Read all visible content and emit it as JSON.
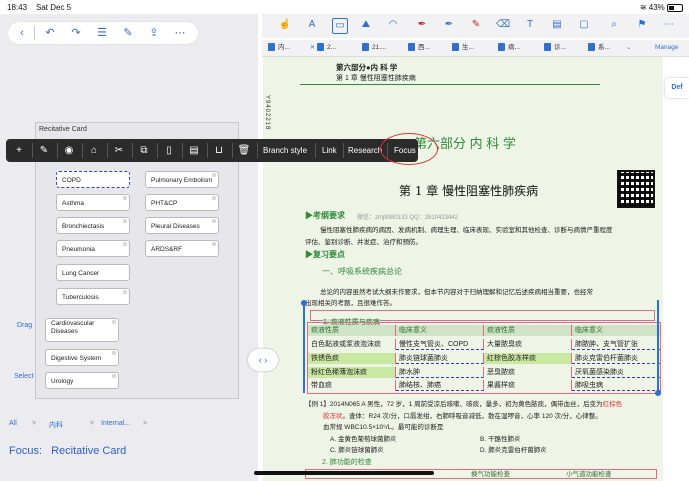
{
  "status": {
    "time": "18:43",
    "date": "Sat Dec 5",
    "battery": "43%"
  },
  "left": {
    "toolbar_icons": [
      "chevron-left-icon",
      "undo-icon",
      "redo-icon",
      "list-icon",
      "edit-icon",
      "share-icon",
      "more-icon"
    ],
    "panel_title": "Recitative Card",
    "cards_left": [
      "COPD",
      "Asthma",
      "Bronchiectasis",
      "Pneumonia",
      "Lung Cancer",
      "Tuberculosis"
    ],
    "cards_right": [
      "Pulmonary Embolism",
      "PHT&CP",
      "Pleural Diseases",
      "ARDS&RF"
    ],
    "cards_bottom": [
      "Cardiovascular Diseases",
      "Digestive System",
      "Urology"
    ],
    "drag_label": "Drag",
    "select_label": "Select",
    "breadcrumb": [
      "All",
      ">",
      "内科",
      ">",
      "Internal...",
      ">"
    ],
    "focus_prefix": "Focus:",
    "focus_value": "Recitative Card"
  },
  "context_menu": {
    "icons": [
      "plus-icon",
      "edit-icon",
      "palette-icon",
      "tag-icon",
      "scissors-icon",
      "copy-icon",
      "document-icon",
      "clipboard-icon",
      "tray-icon",
      "trash-icon"
    ],
    "items": [
      "Branch style",
      "Link",
      "Research",
      "Focus"
    ]
  },
  "right": {
    "tabs": [
      "内...",
      "2...",
      "21....",
      "西...",
      "生...",
      "病...",
      "诊...",
      "系..."
    ],
    "manage": "Manage",
    "def": "Def",
    "page_header_1": "第六部分●内 科 学",
    "page_header_2": "第 1 章  慢性阻塞性肺疾病",
    "side_code": "Y9402218",
    "part_title": "第六部分   内 科 学",
    "chapter_title": "第 1 章   慢性阻塞性肺疾病",
    "exam_req": "▶考纲要求",
    "contact": "微信：zmj8980133   QQ：2610423442",
    "req_text_1": "慢性阻塞性肺疾病的病因、发病机制、病理生理、临床表现、实验室和其他检查、诊断与病情严重程度",
    "req_text_2": "评估、鉴别诊断、并发症、治疗和预防。",
    "review": "▶复习要点",
    "section_1": "一、呼吸系统疾病总论",
    "para_1": "总论的内容虽然考试大纲未作要求，但本节内容对于归纳理解和记忆后述疾病相当重要，也经常",
    "para_2": "出现相关的考题，且很难作答。",
    "table_title": "1. 痰液性质与疾病",
    "table_headers": [
      "痰液性质",
      "临床意义",
      "痰液性质",
      "临床意义"
    ],
    "table_rows": [
      [
        "白色黏液或浆液泡沫痰",
        "慢性支气管炎、COPD",
        "大量脓臭痰",
        "肺脓肿、支气管扩张"
      ],
      [
        "铁锈色痰",
        "肺炎链球菌肺炎",
        "红棕色胶冻样痰",
        "肺炎克雷伯杆菌肺炎"
      ],
      [
        "粉红色稀薄泡沫痰",
        "肺水肿",
        "恶臭脓痰",
        "厌氧菌感染肺炎"
      ],
      [
        "带血痰",
        "肺结核、肺癌",
        "果酱样痰",
        "肺吸虫病"
      ]
    ],
    "example_1": "【例 1】2014N065  A 男性，72 岁，1 周前受凉后咳嗽、咳痰，量多，初为黄色脓痰，偶带血丝，后变为",
    "example_hl": "红棕色",
    "example_2": "胶冻状",
    "example_3": "。查体：R24 次/分，口唇发绀，右肺呼吸音减低，散在湿啰音，心率 120 次/分，心律整。",
    "example_4": "血常规 WBC10.5×10⁹/L。最可能的诊断是",
    "option_a": "A. 金黄色葡萄球菌肺炎",
    "option_b": "B. 干酪性肺炎",
    "option_c": "C. 肺炎链球菌肺炎",
    "option_d": "D. 肺炎克雷伯杆菌肺炎",
    "section_2": "2. 肺功能的检查",
    "table2_headers": [
      "换气功能检查",
      "小气道功能检查"
    ]
  }
}
